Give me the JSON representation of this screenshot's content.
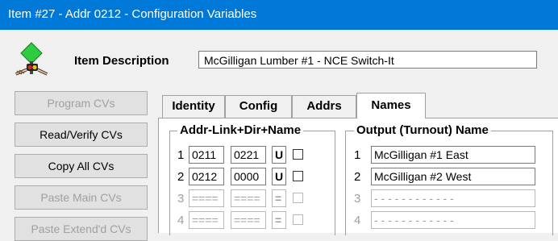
{
  "window": {
    "title": "Item #27 - Addr 0212 - Configuration Variables"
  },
  "header": {
    "icon": "signal-turnout-icon",
    "label": "Item Description",
    "description": "McGilligan Lumber #1 - NCE Switch-It"
  },
  "buttons": [
    {
      "label": "Program CVs",
      "enabled": false
    },
    {
      "label": "Read/Verify CVs",
      "enabled": true
    },
    {
      "label": "Copy All CVs",
      "enabled": true
    },
    {
      "label": "Paste Main CVs",
      "enabled": false
    },
    {
      "label": "Paste Extend'd CVs",
      "enabled": false
    }
  ],
  "tabs": [
    {
      "label": "Identity",
      "active": false
    },
    {
      "label": "Config",
      "active": false
    },
    {
      "label": "Addrs",
      "active": false
    },
    {
      "label": "Names",
      "active": true
    }
  ],
  "addr_group": {
    "title": "Addr-Link+Dir+Name",
    "rows": [
      {
        "num": "1",
        "addr": "0211",
        "link": "0221",
        "dir": "U",
        "checked": false,
        "enabled": true
      },
      {
        "num": "2",
        "addr": "0212",
        "link": "0000",
        "dir": "U",
        "checked": false,
        "enabled": true
      },
      {
        "num": "3",
        "addr": "====",
        "link": "====",
        "dir": "=",
        "checked": false,
        "enabled": false
      },
      {
        "num": "4",
        "addr": "====",
        "link": "====",
        "dir": "=",
        "checked": false,
        "enabled": false
      }
    ]
  },
  "output_group": {
    "title": "Output (Turnout) Name",
    "rows": [
      {
        "num": "1",
        "name": "McGilligan #1 East",
        "enabled": true
      },
      {
        "num": "2",
        "name": "McGilligan #2 West",
        "enabled": true
      },
      {
        "num": "3",
        "name": "- - - - - - - - - - - -",
        "enabled": false
      },
      {
        "num": "4",
        "name": "- - - - - - - - - - - -",
        "enabled": false
      }
    ]
  }
}
